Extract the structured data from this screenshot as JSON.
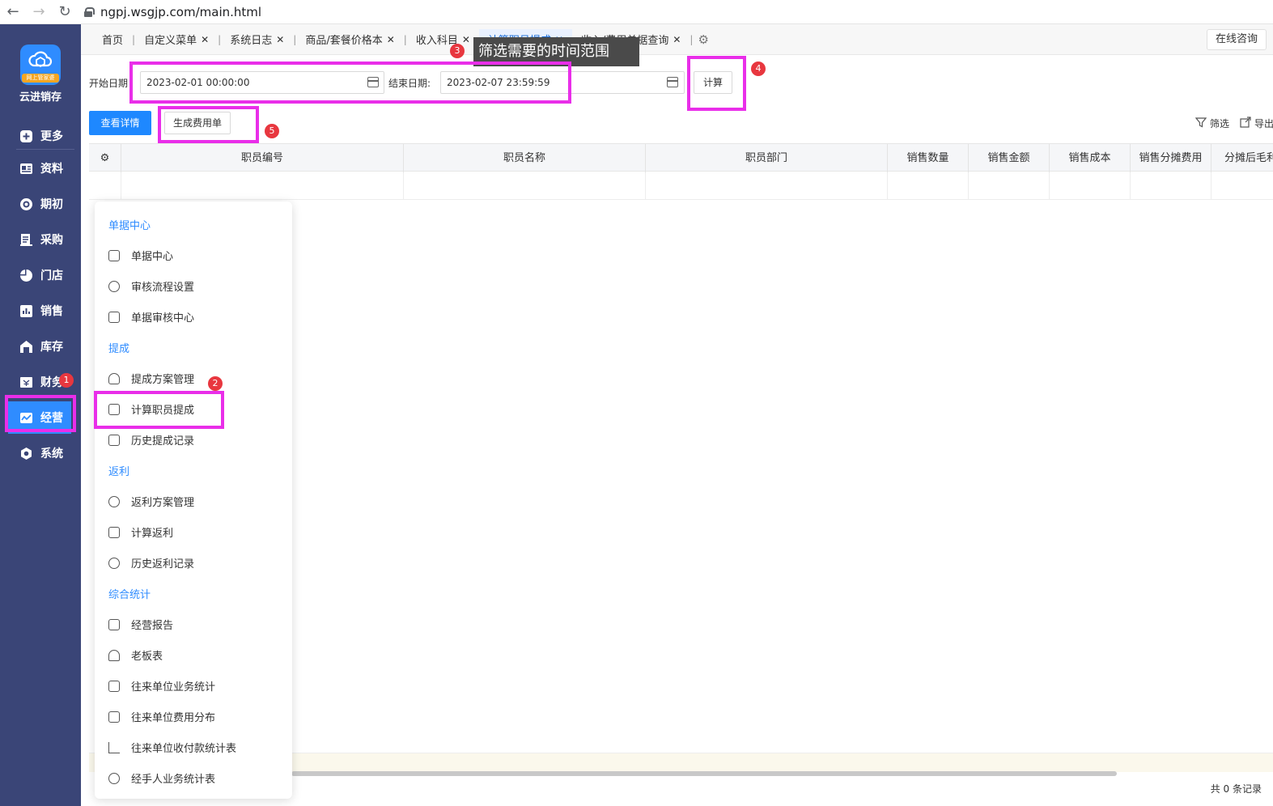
{
  "browser": {
    "url": "ngpj.wsgjp.com/main.html"
  },
  "app": {
    "brand": "云进销存",
    "logo_tag": "网上管家婆"
  },
  "sidebar": {
    "items": [
      {
        "label": "更多",
        "icon": "plus-square-icon"
      },
      {
        "label": "资料",
        "icon": "id-card-icon"
      },
      {
        "label": "期初",
        "icon": "target-icon"
      },
      {
        "label": "采购",
        "icon": "purchase-icon"
      },
      {
        "label": "门店",
        "icon": "pie-icon"
      },
      {
        "label": "销售",
        "icon": "bar-chart-icon"
      },
      {
        "label": "库存",
        "icon": "warehouse-icon"
      },
      {
        "label": "财务",
        "icon": "finance-icon"
      },
      {
        "label": "经营",
        "icon": "operation-icon"
      },
      {
        "label": "系统",
        "icon": "hexagon-gear-icon"
      }
    ],
    "active": "经营"
  },
  "tabs": [
    {
      "label": "首页",
      "closable": false
    },
    {
      "label": "自定义菜单",
      "closable": true
    },
    {
      "label": "系统日志",
      "closable": true
    },
    {
      "label": "商品/套餐价格本",
      "closable": true
    },
    {
      "label": "收入科目",
      "closable": true
    },
    {
      "label": "计算职员提成",
      "closable": true,
      "active": true
    },
    {
      "label": "收入/费用单据查询",
      "closable": true
    }
  ],
  "header": {
    "consult_label": "在线咨询"
  },
  "filter": {
    "start_label": "开始日期",
    "start_value": "2023-02-01 00:00:00",
    "end_label": "结束日期:",
    "end_value": "2023-02-07 23:59:59",
    "calc_button": "计算"
  },
  "toolbar": {
    "detail_button": "查看详情",
    "generate_button": "生成费用单",
    "filter_label": "筛选",
    "export_label": "导出"
  },
  "annotations": {
    "tip_text": "筛选需要的时间范围",
    "badges": [
      "1",
      "2",
      "3",
      "4",
      "5"
    ]
  },
  "table": {
    "columns": [
      "职员编号",
      "职员名称",
      "职员部门",
      "销售数量",
      "销售金额",
      "销售成本",
      "销售分摊费用",
      "分摊后毛利"
    ],
    "total_text": "共 0 条记录"
  },
  "menu": {
    "groups": [
      {
        "title": "单据中心",
        "items": [
          {
            "label": "单据中心",
            "icon": "document-icon"
          },
          {
            "label": "审核流程设置",
            "icon": "flow-icon"
          },
          {
            "label": "单据审核中心",
            "icon": "audit-icon"
          }
        ]
      },
      {
        "title": "提成",
        "items": [
          {
            "label": "提成方案管理",
            "icon": "bulb-icon"
          },
          {
            "label": "计算职员提成",
            "icon": "calc-icon"
          },
          {
            "label": "历史提成记录",
            "icon": "history-icon"
          }
        ]
      },
      {
        "title": "返利",
        "items": [
          {
            "label": "返利方案管理",
            "icon": "rebate-icon"
          },
          {
            "label": "计算返利",
            "icon": "calculator-icon"
          },
          {
            "label": "历史返利记录",
            "icon": "history-rebate-icon"
          }
        ]
      },
      {
        "title": "综合统计",
        "items": [
          {
            "label": "经营报告",
            "icon": "report-icon"
          },
          {
            "label": "老板表",
            "icon": "user-icon"
          },
          {
            "label": "往来单位业务统计",
            "icon": "building-icon"
          },
          {
            "label": "往来单位费用分布",
            "icon": "cost-icon"
          },
          {
            "label": "往来单位收付款统计表",
            "icon": "bars-icon"
          },
          {
            "label": "经手人业务统计表",
            "icon": "handler-icon"
          }
        ]
      }
    ]
  }
}
